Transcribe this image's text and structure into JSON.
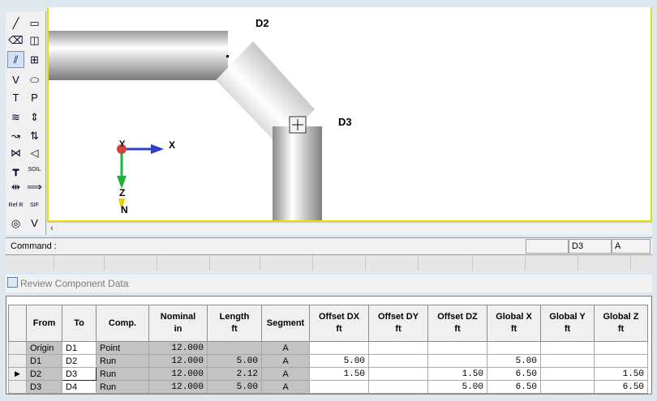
{
  "toolbox": {
    "tools": [
      {
        "name": "line-tool-icon",
        "glyph": "╱"
      },
      {
        "name": "rectangle-tool-icon",
        "glyph": "▭"
      },
      {
        "name": "eraser-tool-icon",
        "glyph": "⌫"
      },
      {
        "name": "split-view-tool-icon",
        "glyph": "◫"
      },
      {
        "name": "pipe-tool-icon",
        "glyph": "⫽"
      },
      {
        "name": "grid-view-tool-icon",
        "glyph": "⊞"
      },
      {
        "name": "valve-v-tool-icon",
        "glyph": "V"
      },
      {
        "name": "vessel-tool-icon",
        "glyph": "⬭"
      },
      {
        "name": "temperature-tool-icon",
        "glyph": "T"
      },
      {
        "name": "pressure-tool-icon",
        "glyph": "P"
      },
      {
        "name": "hanger-tool-icon",
        "glyph": "≋"
      },
      {
        "name": "support-tool-icon",
        "glyph": "⇕"
      },
      {
        "name": "bend-tool-icon",
        "glyph": "↝"
      },
      {
        "name": "restraint-tool-icon",
        "glyph": "⇅"
      },
      {
        "name": "valve-tool-icon",
        "glyph": "⋈"
      },
      {
        "name": "reducer-tool-icon",
        "glyph": "◁"
      },
      {
        "name": "tee-tool-icon",
        "glyph": "┳"
      },
      {
        "name": "soil-tool-icon",
        "glyph": "SOIL"
      },
      {
        "name": "expansion-joint-tool-icon",
        "glyph": "⇹"
      },
      {
        "name": "offset-tool-icon",
        "glyph": "⟹"
      },
      {
        "name": "ref-tool-icon",
        "glyph": "Ref R"
      },
      {
        "name": "sif-tool-icon",
        "glyph": "SIF"
      },
      {
        "name": "flange-tool-icon",
        "glyph": "◎"
      },
      {
        "name": "vent-tool-icon",
        "glyph": "V"
      }
    ]
  },
  "canvas": {
    "node_labels": {
      "d2": "D2",
      "d3": "D3"
    },
    "axes": {
      "x": "X",
      "y": "Y",
      "z": "Z",
      "n": "N"
    }
  },
  "command": {
    "label": "Command :",
    "node": "D3",
    "segment": "A"
  },
  "panel": {
    "title": "Review Component Data"
  },
  "table": {
    "headers": [
      {
        "key": "from",
        "label": "From"
      },
      {
        "key": "to",
        "label": "To"
      },
      {
        "key": "comp",
        "label": "Comp."
      },
      {
        "key": "nominal",
        "label": "Nominal\nin"
      },
      {
        "key": "length",
        "label": "Length\nft"
      },
      {
        "key": "segment",
        "label": "Segment"
      },
      {
        "key": "odx",
        "label": "Offset DX\nft"
      },
      {
        "key": "ody",
        "label": "Offset DY\nft"
      },
      {
        "key": "odz",
        "label": "Offset DZ\nft"
      },
      {
        "key": "gx",
        "label": "Global X\nft"
      },
      {
        "key": "gy",
        "label": "Global Y\nft"
      },
      {
        "key": "gz",
        "label": "Global Z\nft"
      }
    ],
    "rows": [
      {
        "from": "Origin",
        "to": "D1",
        "comp": "Point",
        "nominal": "12.000",
        "length": "",
        "segment": "A",
        "odx": "",
        "ody": "",
        "odz": "",
        "gx": "",
        "gy": "",
        "gz": ""
      },
      {
        "from": "D1",
        "to": "D2",
        "comp": "Run",
        "nominal": "12.000",
        "length": "5.00",
        "segment": "A",
        "odx": "5.00",
        "ody": "",
        "odz": "",
        "gx": "5.00",
        "gy": "",
        "gz": ""
      },
      {
        "from": "D2",
        "to": "D3",
        "comp": "Run",
        "nominal": "12.000",
        "length": "2.12",
        "segment": "A",
        "odx": "1.50",
        "ody": "",
        "odz": "1.50",
        "gx": "6.50",
        "gy": "",
        "gz": "1.50"
      },
      {
        "from": "D3",
        "to": "D4",
        "comp": "Run",
        "nominal": "12.000",
        "length": "5.00",
        "segment": "A",
        "odx": "",
        "ody": "",
        "odz": "5.00",
        "gx": "6.50",
        "gy": "",
        "gz": "6.50"
      }
    ],
    "current_row": 2,
    "current_row_marker": "▶"
  }
}
